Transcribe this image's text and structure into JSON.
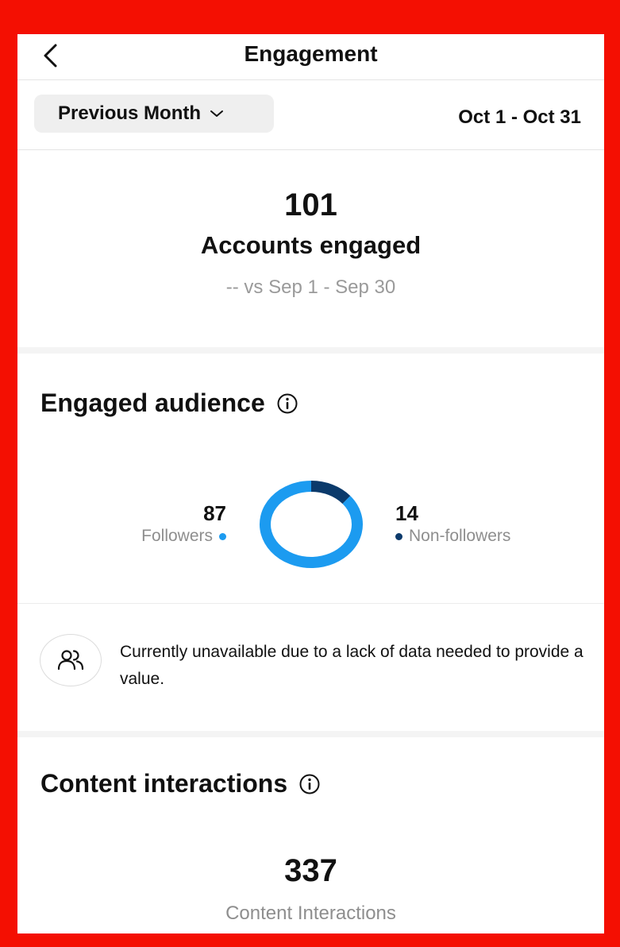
{
  "header": {
    "title": "Engagement",
    "back_icon": "chevron-left-icon"
  },
  "range": {
    "period_label": "Previous Month",
    "date_range": "Oct 1 - Oct 31"
  },
  "summary": {
    "value": "101",
    "label": "Accounts engaged",
    "comparison": "-- vs Sep 1 - Sep 30"
  },
  "audience": {
    "title": "Engaged audience",
    "followers": {
      "value": "87",
      "label": "Followers",
      "color": "#1c9bf0"
    },
    "non_followers": {
      "value": "14",
      "label": "Non-followers",
      "color": "#0b3a6b"
    },
    "chart_values": [
      87,
      14
    ]
  },
  "unavailable": {
    "text": "Currently unavailable due to a lack of data needed to provide a value."
  },
  "interactions": {
    "title": "Content interactions",
    "value": "337",
    "label": "Content Interactions"
  },
  "colors": {
    "frame": "#f40f02"
  }
}
